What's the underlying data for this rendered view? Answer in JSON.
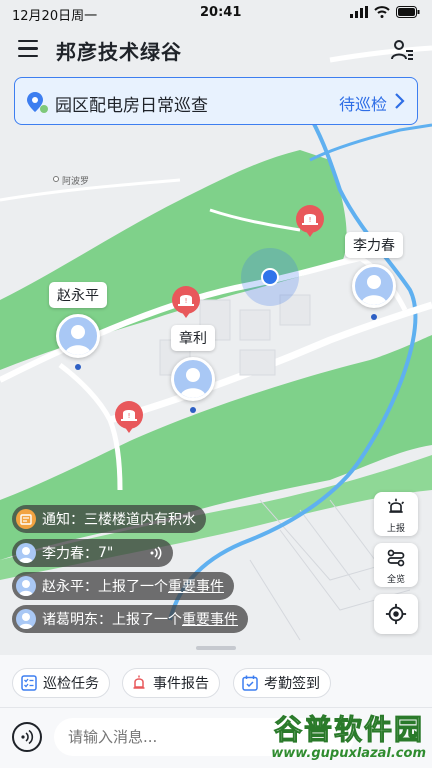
{
  "status_bar": {
    "date": "12月20日周一",
    "time": "20:41"
  },
  "header": {
    "title": "邦彦技术绿谷",
    "menu_icon": "menu-icon",
    "user_icon": "user-list-icon"
  },
  "task_banner": {
    "title": "园区配电房日常巡查",
    "status": "待巡检",
    "icon": "location-pin-icon"
  },
  "map": {
    "place_label": "阿波罗",
    "people": [
      {
        "name": "李力春"
      },
      {
        "name": "赵永平"
      },
      {
        "name": "章利"
      }
    ],
    "alarm_icon": "alarm-bell-icon",
    "accent_color": "#2f74ea",
    "park_color": "#7fd18a"
  },
  "controls": {
    "report_label": "上报",
    "overview_label": "全览",
    "locate_icon": "locate-icon"
  },
  "messages": [
    {
      "prefix": "通知：",
      "text": "三楼楼道内有积水"
    },
    {
      "sender": "李力春：",
      "text": "7\""
    },
    {
      "sender": "赵永平：",
      "text": "上报了一个",
      "link": "重要事件"
    },
    {
      "sender": "诸葛明东：",
      "text": "上报了一个",
      "link": "重要事件"
    }
  ],
  "quick_actions": [
    {
      "label": "巡检任务"
    },
    {
      "label": "事件报告"
    },
    {
      "label": "考勤签到"
    }
  ],
  "composer": {
    "placeholder": "请输入消息..."
  },
  "watermark": {
    "title": "谷普软件园",
    "url": "www.gupuxlazal.com"
  }
}
